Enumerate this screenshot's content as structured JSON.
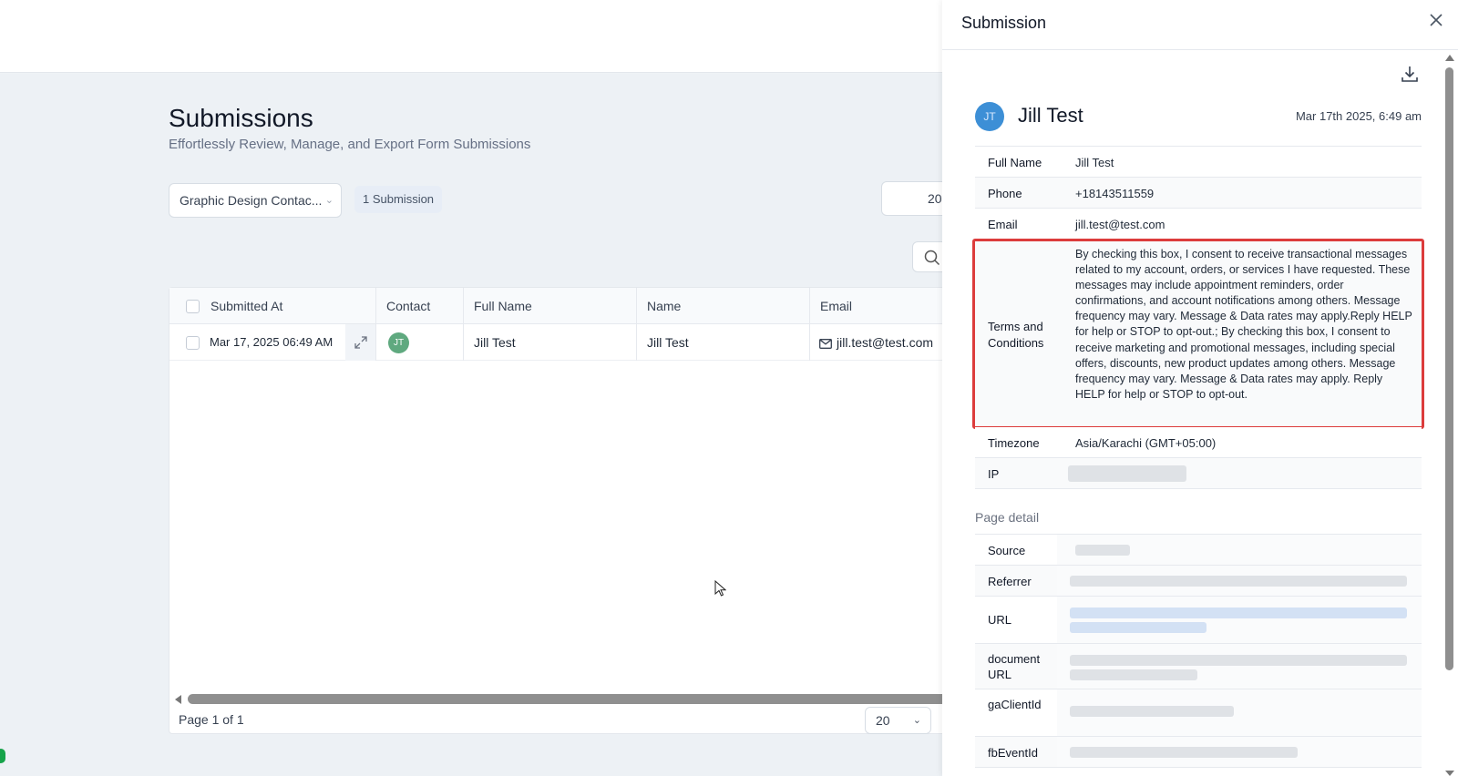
{
  "page": {
    "title": "Submissions",
    "subtitle": "Effortlessly Review, Manage, and Export Form Submissions",
    "form_select": "Graphic Design Contac...",
    "count_badge": "1 Submission",
    "per_page_top": "20"
  },
  "table": {
    "headers": [
      "Submitted At",
      "Contact",
      "Full Name",
      "Name",
      "Email"
    ],
    "rows": [
      {
        "submitted_at": "Mar 17, 2025 06:49 AM",
        "contact_initials": "JT",
        "full_name": "Jill Test",
        "name": "Jill Test",
        "email": "jill.test@test.com"
      }
    ],
    "pagination": "Page 1 of 1",
    "per_page": "20"
  },
  "drawer": {
    "title": "Submission",
    "contact": {
      "initials": "JT",
      "name": "Jill Test",
      "date": "Mar 17th 2025, 6:49 am"
    },
    "fields": {
      "full_name_label": "Full Name",
      "full_name": "Jill Test",
      "phone_label": "Phone",
      "phone": "+18143511559",
      "email_label": "Email",
      "email": "jill.test@test.com",
      "terms_label": "Terms and Conditions",
      "terms": "By checking this box, I consent to receive transactional messages related to my account, orders, or services I have requested. These messages may include appointment reminders, order confirmations, and account notifications among others. Message frequency may vary. Message & Data rates may apply.Reply HELP for help or STOP to opt-out.; By checking this box, I consent to receive marketing and promotional messages, including special offers, discounts, new product updates among others. Message frequency may vary. Message & Data rates may apply. Reply HELP for help or STOP to opt-out.",
      "timezone_label": "Timezone",
      "timezone": "Asia/Karachi (GMT+05:00)",
      "ip_label": "IP"
    },
    "page_detail": {
      "title": "Page detail",
      "source_label": "Source",
      "referrer_label": "Referrer",
      "url_label": "URL",
      "document_url_label": "document URL",
      "ga_client_id_label": "gaClientId",
      "fb_event_id_label": "fbEventId"
    }
  },
  "colors": {
    "highlight": "#dc3c3c",
    "avatar_contact": "#5fa97f",
    "avatar_drawer": "#3d8fd6"
  }
}
